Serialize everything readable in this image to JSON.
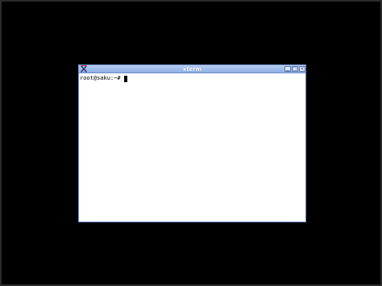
{
  "window": {
    "title": "xterm",
    "icon": "xterm-x-icon",
    "controls": {
      "minimize": "minimize-icon",
      "maximize": "maximize-icon",
      "close": "close-icon"
    }
  },
  "terminal": {
    "prompt": "root@saku:~#"
  },
  "colors": {
    "desktop": "#000000",
    "titlebar": "#8fb0e6",
    "terminal_bg": "#ffffff",
    "text": "#000000"
  }
}
